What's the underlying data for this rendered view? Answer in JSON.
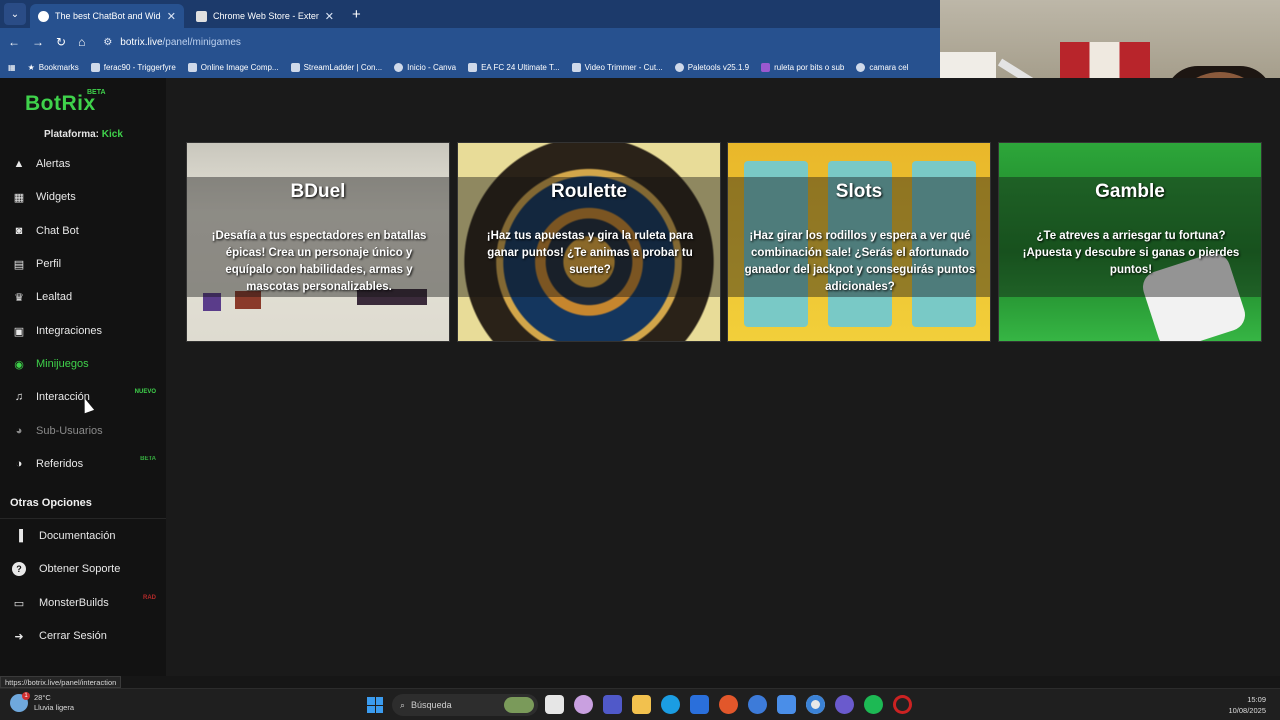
{
  "browser": {
    "tabs": [
      {
        "label": "The best ChatBot and Widgets",
        "active": true
      },
      {
        "label": "Chrome Web Store - Extensions",
        "active": false
      }
    ],
    "url_host": "botrix.live",
    "url_path": "/panel/minigames",
    "bookmarks": [
      "Bookmarks",
      "ferac90 - Triggerfyre",
      "Online Image Comp...",
      "StreamLadder | Con...",
      "Inicio - Canva",
      "EA FC 24 Ultimate T...",
      "Video Trimmer - Cut...",
      "Paletools v25.1.9",
      "ruleta por bits o sub",
      "camara cel"
    ]
  },
  "app": {
    "brand": "BotRix",
    "brand_badge": "BETA",
    "platform_label": "Plataforma:",
    "platform_value": "Kick"
  },
  "nav": [
    {
      "label": "Alertas",
      "icon": "alert-icon",
      "glyph": "▲"
    },
    {
      "label": "Widgets",
      "icon": "widgets-icon",
      "glyph": "▦"
    },
    {
      "label": "Chat Bot",
      "icon": "robot-icon",
      "glyph": "◙"
    },
    {
      "label": "Perfil",
      "icon": "profile-card-icon",
      "glyph": "▤"
    },
    {
      "label": "Lealtad",
      "icon": "trophy-icon",
      "glyph": "♛"
    },
    {
      "label": "Integraciones",
      "icon": "integrations-icon",
      "glyph": "▣"
    },
    {
      "label": "Minijuegos",
      "icon": "gamepad-icon",
      "glyph": "◉"
    },
    {
      "label": "Interacción",
      "icon": "music-note-icon",
      "glyph": "♫",
      "badge": "NUEVO"
    },
    {
      "label": "Sub-Usuarios",
      "icon": "users-icon",
      "glyph": "◕"
    },
    {
      "label": "Referidos",
      "icon": "referrals-icon",
      "glyph": "◑",
      "badge": "BETA"
    }
  ],
  "other_section_title": "Otras Opciones",
  "other": [
    {
      "label": "Documentación",
      "icon": "book-icon",
      "glyph": "▐"
    },
    {
      "label": "Obtener Soporte",
      "icon": "help-icon",
      "glyph": "?"
    },
    {
      "label": "MonsterBuilds",
      "icon": "monitor-icon",
      "glyph": "▭",
      "badge": "RAD"
    },
    {
      "label": "Cerrar Sesión",
      "icon": "logout-icon",
      "glyph": "➜"
    }
  ],
  "games": [
    {
      "title": "BDuel",
      "description": "¡Desafía a tus espectadores en batallas épicas! Crea un personaje único y equípalo con habilidades, armas y mascotas personalizables."
    },
    {
      "title": "Roulette",
      "description": "¡Haz tus apuestas y gira la ruleta para ganar puntos! ¿Te animas a probar tu suerte?"
    },
    {
      "title": "Slots",
      "description": "¡Haz girar los rodillos y espera a ver qué combinación sale! ¿Serás el afortunado ganador del jackpot y conseguirás puntos adicionales?"
    },
    {
      "title": "Gamble",
      "description": "¿Te atreves a arriesgar tu fortuna? ¡Apuesta y descubre si ganas o pierdes puntos!"
    }
  ],
  "status_url": "https://botrix.live/panel/interaction",
  "taskbar": {
    "temperature": "28°C",
    "weather": "Lluvia ligera",
    "weather_badge": "1",
    "search_placeholder": "Búsqueda",
    "time": "15:09",
    "date": "10/08/2025"
  },
  "colors": {
    "accent": "#3fd24b",
    "sidebar_bg": "#121212",
    "main_bg": "#1a1a1a",
    "browser_blue": "#27518f"
  }
}
